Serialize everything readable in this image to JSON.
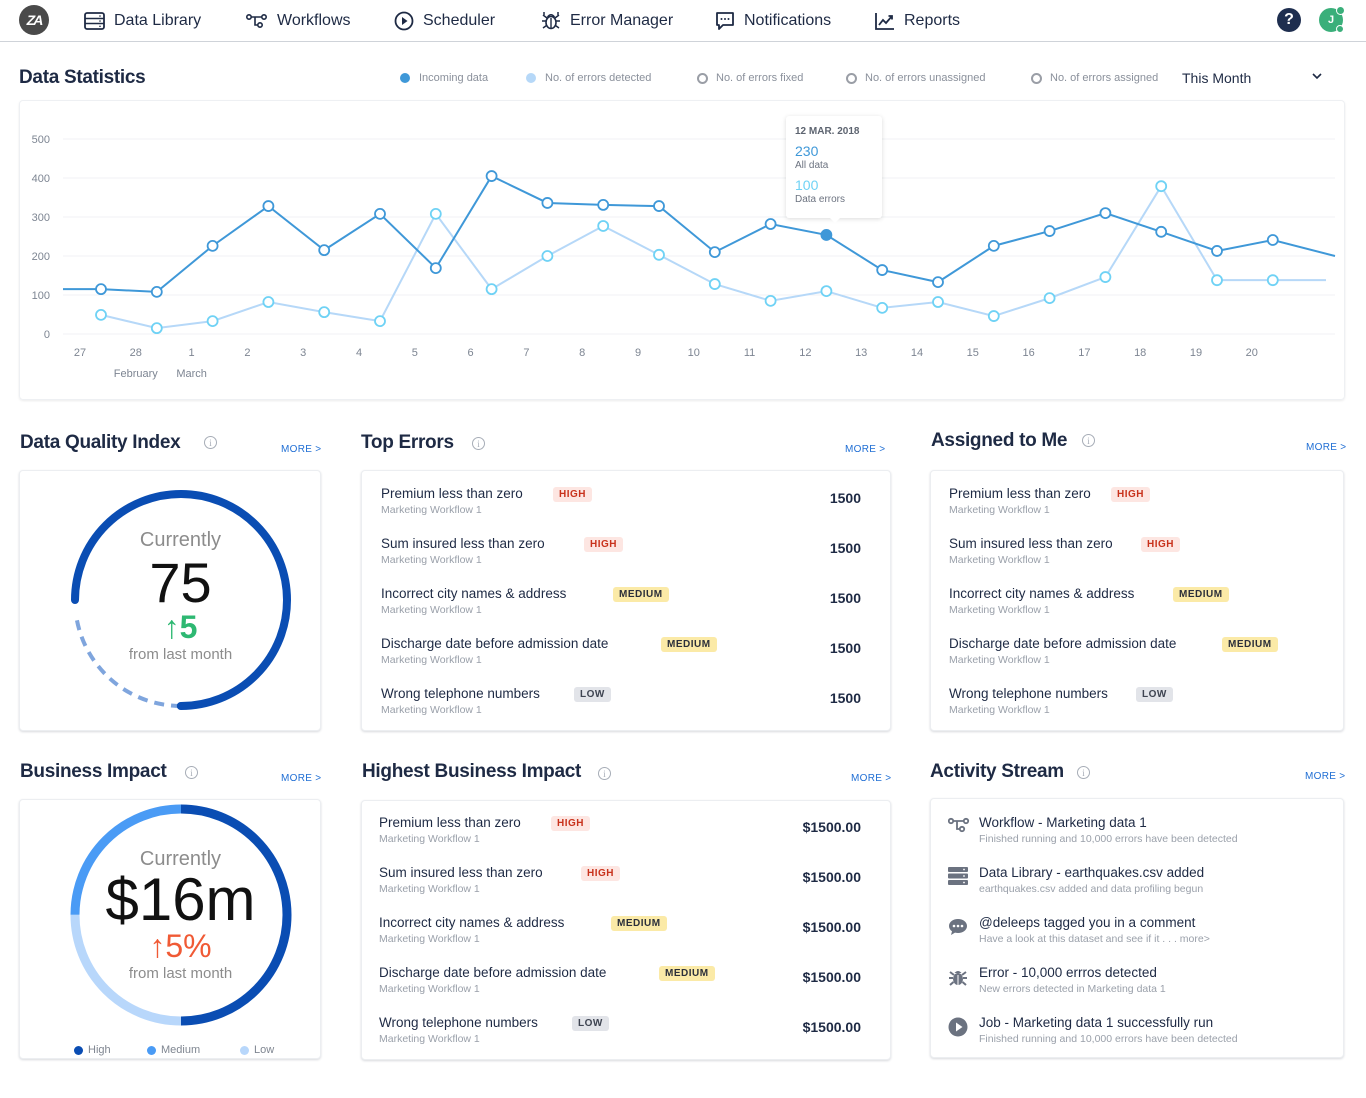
{
  "nav": {
    "logo_text": "ZA",
    "items": [
      {
        "label": "Data Library",
        "icon": "database-icon"
      },
      {
        "label": "Workflows",
        "icon": "workflow-icon"
      },
      {
        "label": "Scheduler",
        "icon": "play-circle-icon"
      },
      {
        "label": "Error Manager",
        "icon": "bug-icon"
      },
      {
        "label": "Notifications",
        "icon": "chat-icon"
      },
      {
        "label": "Reports",
        "icon": "chart-line-icon"
      }
    ],
    "help_label": "?",
    "avatar_initial": "J"
  },
  "stats": {
    "title": "Data Statistics",
    "legend": [
      {
        "label": "Incoming data",
        "color": "#3f98d8",
        "style": "dot"
      },
      {
        "label": "No. of errors detected",
        "color": "#b6d8f8",
        "style": "dot"
      },
      {
        "label": "No. of errors fixed",
        "color": "#9a9ea6",
        "style": "ring"
      },
      {
        "label": "No. of errors unassigned",
        "color": "#9a9ea6",
        "style": "ring"
      },
      {
        "label": "No. of errors assigned",
        "color": "#9a9ea6",
        "style": "ring"
      }
    ],
    "period": "This Month",
    "period_chevron": "⌄",
    "tooltip": {
      "date": "12 MAR. 2018",
      "value1": "230",
      "label1": "All data",
      "value2": "100",
      "label2": "Data errors"
    }
  },
  "chart_data": {
    "type": "line",
    "title": "Data Statistics",
    "xlabel": "",
    "ylabel": "",
    "ylim": [
      0,
      500
    ],
    "yticks": [
      0,
      100,
      200,
      300,
      400,
      500
    ],
    "grid": true,
    "legend_position": "top-right",
    "x_tick_labels": [
      "27",
      "28",
      "1",
      "2",
      "3",
      "4",
      "5",
      "6",
      "7",
      "8",
      "9",
      "10",
      "11",
      "12",
      "13",
      "14",
      "15",
      "16",
      "17",
      "18",
      "19",
      "20"
    ],
    "month_labels": [
      {
        "label": "February",
        "at": "28"
      },
      {
        "label": "March",
        "at": "1"
      }
    ],
    "series": [
      {
        "name": "Incoming data",
        "color": "#3f98d8",
        "lead_in": 115,
        "values": [
          115,
          108,
          226,
          328,
          215,
          308,
          169,
          405,
          336,
          331,
          328,
          210,
          282,
          254,
          164,
          133,
          226,
          264,
          310,
          262,
          213,
          241
        ],
        "tail": 200,
        "highlight_index": 13
      },
      {
        "name": "No. of errors detected",
        "color": "#b6d8f8",
        "marker_color": "#6fd2f5",
        "values": [
          49,
          15,
          33,
          82,
          56,
          33,
          308,
          115,
          200,
          277,
          203,
          128,
          85,
          110,
          67,
          82,
          46,
          92,
          146,
          379,
          138,
          138
        ],
        "tail": 138
      }
    ]
  },
  "dqi": {
    "title": "Data Quality Index",
    "more": "MORE >",
    "currently": "Currently",
    "value": "75",
    "delta": "↑5",
    "from": "from last month",
    "progress_fraction": 0.75,
    "color": "#0a4db3",
    "delta_color": "#2eb872"
  },
  "top_errors": {
    "title": "Top Errors",
    "more": "MORE >",
    "rows": [
      {
        "title": "Premium less than zero",
        "sub": "Marketing Workflow 1",
        "badge": "HIGH",
        "level": "high",
        "value": "1500"
      },
      {
        "title": "Sum insured less than zero",
        "sub": "Marketing Workflow 1",
        "badge": "HIGH",
        "level": "high",
        "value": "1500"
      },
      {
        "title": "Incorrect city names & address",
        "sub": "Marketing Workflow 1",
        "badge": "MEDIUM",
        "level": "medium",
        "value": "1500"
      },
      {
        "title": "Discharge date before admission date",
        "sub": "Marketing Workflow 1",
        "badge": "MEDIUM",
        "level": "medium",
        "value": "1500"
      },
      {
        "title": "Wrong telephone numbers",
        "sub": "Marketing Workflow 1",
        "badge": "LOW",
        "level": "low",
        "value": "1500"
      }
    ]
  },
  "assigned": {
    "title": "Assigned to Me",
    "more": "MORE >",
    "rows": [
      {
        "title": "Premium less than zero",
        "sub": "Marketing Workflow 1",
        "badge": "HIGH",
        "level": "high"
      },
      {
        "title": "Sum insured less than zero",
        "sub": "Marketing Workflow 1",
        "badge": "HIGH",
        "level": "high"
      },
      {
        "title": "Incorrect city names & address",
        "sub": "Marketing Workflow 1",
        "badge": "MEDIUM",
        "level": "medium"
      },
      {
        "title": "Discharge date before admission date",
        "sub": "Marketing Workflow 1",
        "badge": "MEDIUM",
        "level": "medium"
      },
      {
        "title": "Wrong telephone numbers",
        "sub": "Marketing Workflow 1",
        "badge": "LOW",
        "level": "low"
      }
    ]
  },
  "business": {
    "title": "Business Impact",
    "more": "MORE >",
    "currently": "Currently",
    "value": "$16m",
    "delta": "↑5%",
    "from": "from last month",
    "delta_color": "#f05a35",
    "segments": [
      {
        "label": "High",
        "fraction": 0.5,
        "color": "#0a4db3"
      },
      {
        "label": "Medium",
        "fraction": 0.25,
        "color": "#4a9bf5"
      },
      {
        "label": "Low",
        "fraction": 0.25,
        "color": "#b8d7fb"
      }
    ]
  },
  "highest": {
    "title": "Highest Business Impact",
    "more": "MORE >",
    "rows": [
      {
        "title": "Premium less than zero",
        "sub": "Marketing Workflow 1",
        "badge": "HIGH",
        "level": "high",
        "value": "$1500.00"
      },
      {
        "title": "Sum insured less than zero",
        "sub": "Marketing Workflow 1",
        "badge": "HIGH",
        "level": "high",
        "value": "$1500.00"
      },
      {
        "title": "Incorrect city names & address",
        "sub": "Marketing Workflow 1",
        "badge": "MEDIUM",
        "level": "medium",
        "value": "$1500.00"
      },
      {
        "title": "Discharge date before admission date",
        "sub": "Marketing Workflow 1",
        "badge": "MEDIUM",
        "level": "medium",
        "value": "$1500.00"
      },
      {
        "title": "Wrong telephone numbers",
        "sub": "Marketing Workflow 1",
        "badge": "LOW",
        "level": "low",
        "value": "$1500.00"
      }
    ]
  },
  "activity": {
    "title": "Activity Stream",
    "more": "MORE >",
    "rows": [
      {
        "icon": "workflow-icon",
        "title": "Workflow - Marketing data 1",
        "sub": "Finished running and 10,000 errors have been detected"
      },
      {
        "icon": "database-icon",
        "title": "Data Library - earthquakes.csv added",
        "sub": "earthquakes.csv added and data profiling begun"
      },
      {
        "icon": "comment-icon",
        "title": "@deleeps tagged you in a comment",
        "sub": "Have a look at this dataset and see if it . . . more>"
      },
      {
        "icon": "bug-icon",
        "title": "Error - 10,000 errros detected",
        "sub": "New errors detected in Marketing data 1"
      },
      {
        "icon": "play-circle-icon",
        "title": "Job - Marketing data 1 successfully run",
        "sub": "Finished running and 10,000 errors have been detected"
      }
    ]
  }
}
